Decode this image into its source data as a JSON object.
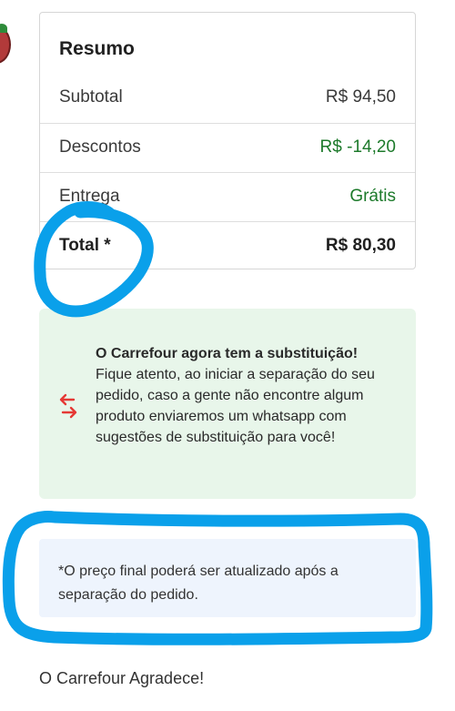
{
  "summary": {
    "title": "Resumo",
    "rows": [
      {
        "label": "Subtotal",
        "value": "R$ 94,50"
      },
      {
        "label": "Descontos",
        "value": "R$ -14,20"
      },
      {
        "label": "Entrega",
        "value": "Grátis"
      },
      {
        "label": "Total *",
        "value": "R$ 80,30"
      }
    ]
  },
  "substitution": {
    "title": "O Carrefour agora tem a substituição!",
    "body": "Fique atento, ao iniciar a separação do seu pedido, caso a gente não encontre algum produto enviaremos um whatsapp com sugestões de substituição para você!"
  },
  "notice": {
    "text": "*O preço final poderá ser atualizado após a separação do pedido."
  },
  "footer": {
    "thanks": "O Carrefour Agradece!"
  },
  "colors": {
    "green_value": "#1d7a2b",
    "substitution_bg": "#e8f6ea",
    "notice_bg": "#eef4fd",
    "annotation_blue": "#0aa0ea",
    "swap_arrow_red": "#e53935"
  }
}
